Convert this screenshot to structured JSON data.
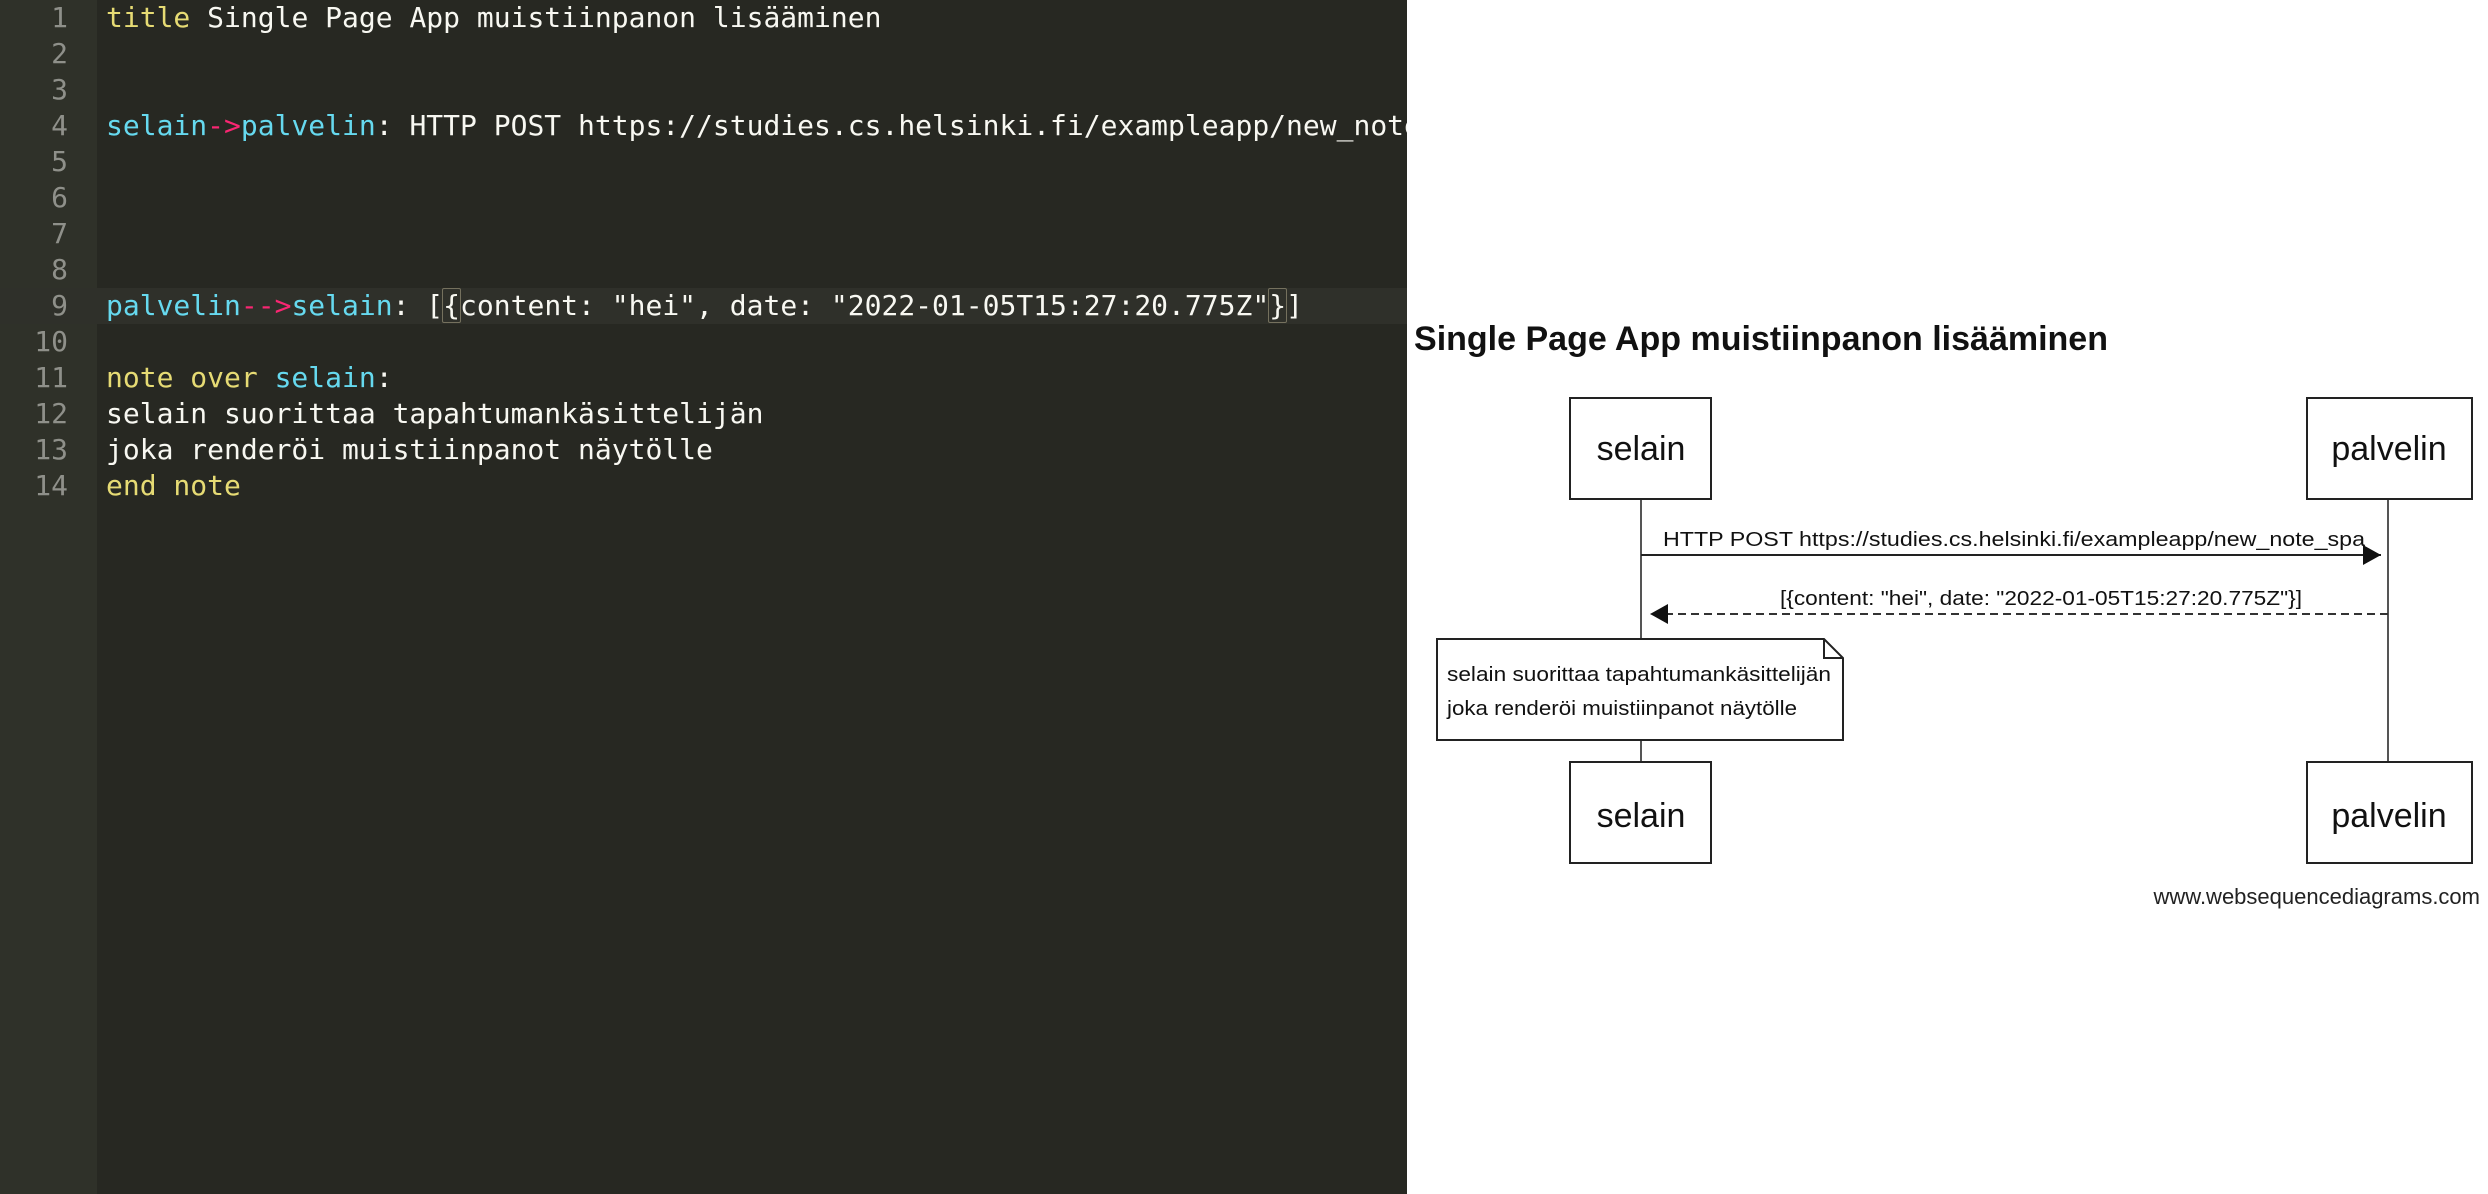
{
  "editor": {
    "lines": [
      {
        "number": "1",
        "tokens": [
          {
            "t": "title",
            "c": "kw"
          },
          {
            "t": " Single Page App muistiinpanon lisääminen",
            "c": "tx"
          }
        ]
      },
      {
        "number": "2",
        "tokens": []
      },
      {
        "number": "3",
        "tokens": []
      },
      {
        "number": "4",
        "tokens": [
          {
            "t": "selain",
            "c": "id"
          },
          {
            "t": "->",
            "c": "ar"
          },
          {
            "t": "palvelin",
            "c": "id"
          },
          {
            "t": ": HTTP POST https://studies.cs.helsinki.fi/exampleapp/new_note_",
            "c": "tx"
          }
        ]
      },
      {
        "number": "5",
        "tokens": []
      },
      {
        "number": "6",
        "tokens": []
      },
      {
        "number": "7",
        "tokens": []
      },
      {
        "number": "8",
        "tokens": []
      },
      {
        "number": "9",
        "active": true,
        "tokens": [
          {
            "t": "palvelin",
            "c": "id"
          },
          {
            "t": "-->",
            "c": "ar"
          },
          {
            "t": "selain",
            "c": "id"
          },
          {
            "t": ": [",
            "c": "tx"
          },
          {
            "t": "{",
            "c": "tx",
            "b": true
          },
          {
            "t": "content: \"hei\", date: \"2022-01-05T15:27:20.775Z\"",
            "c": "tx"
          },
          {
            "t": "}",
            "c": "tx",
            "b": true
          },
          {
            "t": "]",
            "c": "tx"
          }
        ]
      },
      {
        "number": "10",
        "tokens": []
      },
      {
        "number": "11",
        "tokens": [
          {
            "t": "note over",
            "c": "kw"
          },
          {
            "t": " ",
            "c": "tx"
          },
          {
            "t": "selain",
            "c": "id"
          },
          {
            "t": ":",
            "c": "tx"
          }
        ]
      },
      {
        "number": "12",
        "tokens": [
          {
            "t": "selain suorittaa tapahtumankäsittelijän",
            "c": "tx"
          }
        ]
      },
      {
        "number": "13",
        "tokens": [
          {
            "t": "joka renderöi muistiinpanot näytölle",
            "c": "tx"
          }
        ]
      },
      {
        "number": "14",
        "tokens": [
          {
            "t": "end note",
            "c": "kw"
          }
        ]
      }
    ],
    "colors": {
      "background": "#272822",
      "gutter": "#2f3129",
      "keyword": "#e6db74",
      "identifier": "#66d9ef",
      "arrow": "#f92672",
      "text": "#f8f8f2",
      "line_number": "#8f908a"
    }
  },
  "diagram": {
    "title": "Single Page App muistiinpanon lisääminen",
    "participants": [
      {
        "id": "selain",
        "label": "selain"
      },
      {
        "id": "palvelin",
        "label": "palvelin"
      }
    ],
    "messages": [
      {
        "from": "selain",
        "to": "palvelin",
        "style": "solid",
        "label": "HTTP POST https://studies.cs.helsinki.fi/exampleapp/new_note_spa"
      },
      {
        "from": "palvelin",
        "to": "selain",
        "style": "dashed",
        "label": "[{content: \"hei\", date: \"2022-01-05T15:27:20.775Z\"}]"
      }
    ],
    "note": {
      "over": "selain",
      "lines": [
        "selain suorittaa tapahtumankäsittelijän",
        "joka renderöi muistiinpanot näytölle"
      ]
    },
    "watermark": "www.websequencediagrams.com"
  }
}
